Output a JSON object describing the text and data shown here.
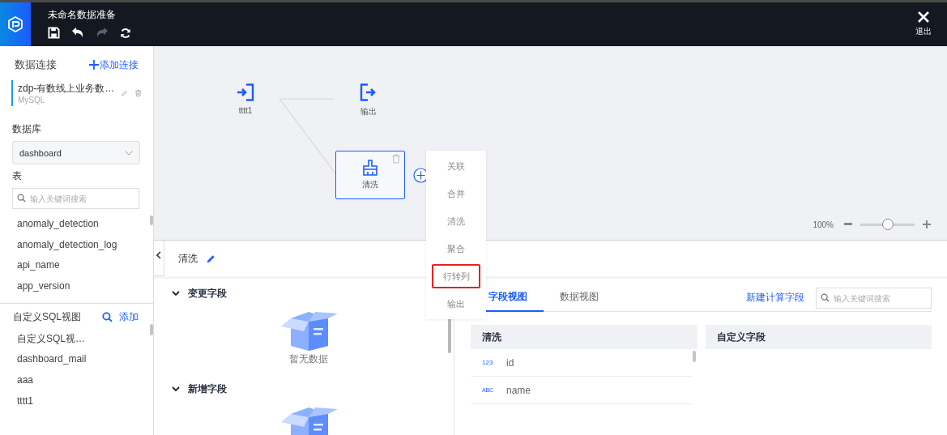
{
  "header": {
    "title": "未命名数据准备",
    "toolbar": [
      {
        "kind": "save",
        "disabled": false
      },
      {
        "kind": "undo",
        "disabled": false
      },
      {
        "kind": "redo",
        "disabled": true
      },
      {
        "kind": "refresh",
        "disabled": false
      }
    ],
    "exit_label": "退出"
  },
  "sidebar": {
    "connections_title": "数据连接",
    "add_connection": "添加连接",
    "connection": {
      "name": "zdp-有数线上业务数…",
      "type": "MySQL",
      "selected": true
    },
    "database_label": "数据库",
    "database_value": "dashboard",
    "table_label": "表",
    "table_search_placeholder": "输入关键词搜索",
    "tables": [
      "anomaly_detection",
      "anomaly_detection_log",
      "api_name",
      "app_version"
    ],
    "sql_title": "自定义SQL视图",
    "sql_add": "添加",
    "sql_views": [
      "自定义SQL视…",
      "dashboard_mail",
      "aaa",
      "tttt1"
    ]
  },
  "canvas": {
    "nodes": [
      {
        "kind": "input",
        "label": "tttt1",
        "selected": false
      },
      {
        "kind": "output",
        "label": "输出",
        "selected": false
      },
      {
        "kind": "clean",
        "label": "清洗",
        "selected": true
      }
    ],
    "zoom": {
      "reading": "100%",
      "level": 0.5
    },
    "menu": [
      {
        "label": "关联",
        "highlighted": false
      },
      {
        "label": "合并",
        "highlighted": false
      },
      {
        "label": "清洗",
        "highlighted": false
      },
      {
        "label": "聚合",
        "highlighted": false
      },
      {
        "label": "行转列",
        "highlighted": true
      },
      {
        "label": "输出",
        "highlighted": false
      }
    ]
  },
  "bottom": {
    "title": "清洗",
    "sections": [
      {
        "title": "变更字段",
        "expanded": true,
        "empty_text": "暂无数据"
      },
      {
        "title": "新增字段",
        "expanded": true
      }
    ],
    "tabs": [
      {
        "label": "字段视图",
        "selected": true
      },
      {
        "label": "数据视图",
        "selected": false
      }
    ],
    "new_field_link": "新建计算字段",
    "search_placeholder": "输入关键词搜索",
    "source_table": {
      "title": "清洗",
      "fields": [
        {
          "kind": "number",
          "type_label": "123",
          "name": "id"
        },
        {
          "kind": "string",
          "type_label": "ABC",
          "name": "name"
        }
      ]
    },
    "custom_table": {
      "title": "自定义字段"
    }
  }
}
